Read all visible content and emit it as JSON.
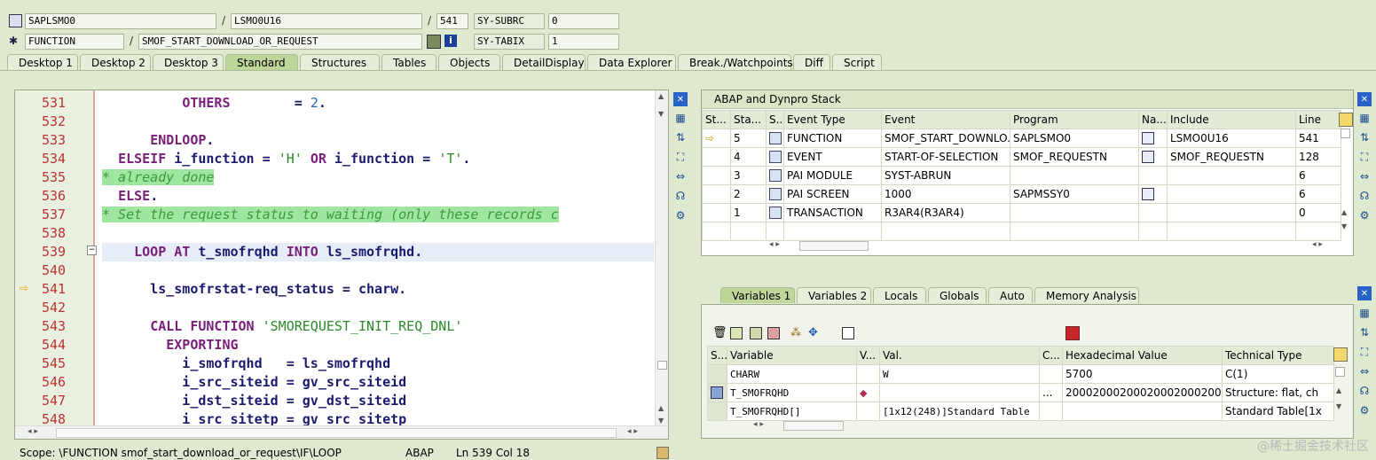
{
  "header": {
    "program": "SAPLSMO0",
    "include": "LSMO0U16",
    "line": "541",
    "sy_subrc_label": "SY-SUBRC",
    "sy_subrc": "0",
    "kind": "FUNCTION",
    "name": "SMOF_START_DOWNLOAD_OR_REQUEST",
    "sy_tabix_label": "SY-TABIX",
    "sy_tabix": "1"
  },
  "tabs": [
    "Desktop 1",
    "Desktop 2",
    "Desktop 3",
    "Standard",
    "Structures",
    "Tables",
    "Objects",
    "DetailDisplay",
    "Data Explorer",
    "Break./Watchpoints",
    "Diff",
    "Script"
  ],
  "active_tab": "Standard",
  "code": {
    "lines": [
      {
        "n": "531",
        "t": "          OTHERS        = 2."
      },
      {
        "n": "532",
        "t": ""
      },
      {
        "n": "533",
        "t": "      ENDLOOP."
      },
      {
        "n": "534",
        "t": "  ELSEIF i_function = 'H' OR i_function = 'T'."
      },
      {
        "n": "535",
        "t": "* already done"
      },
      {
        "n": "536",
        "t": "  ELSE."
      },
      {
        "n": "537",
        "t": "* Set the request status to waiting (only these records c"
      },
      {
        "n": "538",
        "t": ""
      },
      {
        "n": "539",
        "t": "    LOOP AT t_smofrqhd INTO ls_smofrqhd."
      },
      {
        "n": "540",
        "t": ""
      },
      {
        "n": "541",
        "t": "      ls_smofrstat-req_status = charw."
      },
      {
        "n": "542",
        "t": ""
      },
      {
        "n": "543",
        "t": "      CALL FUNCTION 'SMOREQUEST_INIT_REQ_DNL'"
      },
      {
        "n": "544",
        "t": "        EXPORTING"
      },
      {
        "n": "545",
        "t": "          i_smofrqhd   = ls_smofrqhd"
      },
      {
        "n": "546",
        "t": "          i_src_siteid = gv_src_siteid"
      },
      {
        "n": "547",
        "t": "          i_dst_siteid = gv_dst_siteid"
      },
      {
        "n": "548",
        "t": "          i_src_sitetp = gv_src_sitetp"
      }
    ]
  },
  "status": {
    "scope": "Scope: \\FUNCTION smof_start_download_or_request\\IF\\LOOP",
    "lang": "ABAP",
    "pos": "Ln 539 Col  18"
  },
  "stack": {
    "title": "ABAP and Dynpro Stack",
    "headers": [
      "St...",
      "Sta...",
      "S...",
      "Event Type",
      "Event",
      "Program",
      "Na...",
      "Include",
      "Line"
    ],
    "rows": [
      {
        "level": "5",
        "type": "FUNCTION",
        "event": "SMOF_START_DOWNLO...",
        "program": "SAPLSMO0",
        "include": "LSMO0U16",
        "line": "541",
        "current": true,
        "nav": true
      },
      {
        "level": "4",
        "type": "EVENT",
        "event": "START-OF-SELECTION",
        "program": "SMOF_REQUESTN",
        "include": "SMOF_REQUESTN",
        "line": "128",
        "current": false,
        "nav": true
      },
      {
        "level": "3",
        "type": "PAI MODULE",
        "event": "SYST-ABRUN",
        "program": "",
        "include": "",
        "line": "6",
        "current": false,
        "nav": false
      },
      {
        "level": "2",
        "type": "PAI SCREEN",
        "event": "1000",
        "program": "SAPMSSY0",
        "include": "",
        "line": "6",
        "current": false,
        "nav": true
      },
      {
        "level": "1",
        "type": "TRANSACTION",
        "event": "R3AR4(R3AR4)",
        "program": "",
        "include": "",
        "line": "0",
        "current": false,
        "nav": false
      }
    ]
  },
  "var_tabs": [
    "Variables 1",
    "Variables 2",
    "Locals",
    "Globals",
    "Auto",
    "Memory Analysis"
  ],
  "active_var_tab": "Variables 1",
  "vars": {
    "headers": [
      "S...",
      "Variable",
      "V...",
      "Val.",
      "C...",
      "Hexadecimal Value",
      "Technical Type"
    ],
    "rows": [
      {
        "name": "CHARW",
        "val": "W",
        "c": "",
        "hex": "5700",
        "type": "C(1)"
      },
      {
        "name": "T_SMOFRQHD",
        "val": "",
        "c": "...",
        "hex": "200020002000200020002000...",
        "type": "Structure: flat, ch"
      },
      {
        "name": "T_SMOFRQHD[]",
        "val": "[1x12(248)]Standard Table",
        "c": "",
        "hex": "",
        "type": "Standard Table[1x"
      }
    ]
  },
  "watermark": "@稀土掘金技术社区"
}
